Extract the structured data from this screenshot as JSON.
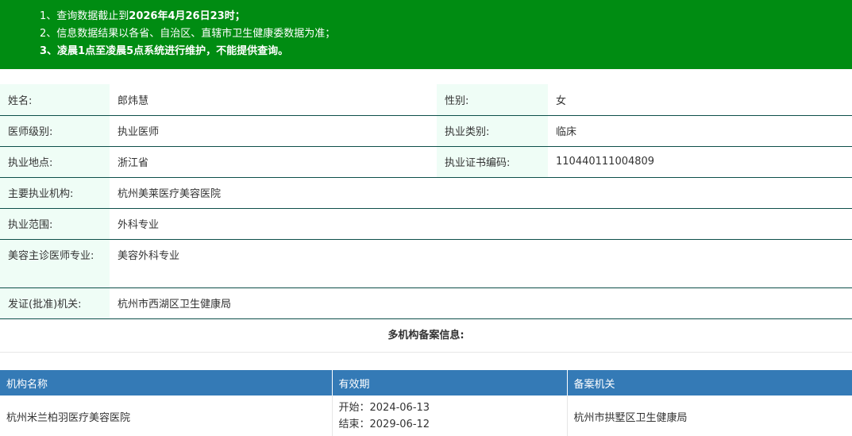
{
  "notice": {
    "line1_prefix": "1、查询数据截止到",
    "line1_bold": "2026年4月26日23时；",
    "line2": "2、信息数据结果以各省、自治区、直辖市卫生健康委数据为准；",
    "line3_prefix": "3、",
    "line3_bold": "凌晨1点至凌晨5点",
    "line3_suffix": "系统进行维护，不能提供查询。"
  },
  "info": {
    "name_label": "姓名:",
    "name_value": "郎炜慧",
    "gender_label": "性别:",
    "gender_value": "女",
    "level_label": "医师级别:",
    "level_value": "执业医师",
    "category_label": "执业类别:",
    "category_value": "临床",
    "location_label": "执业地点:",
    "location_value": "浙江省",
    "cert_label": "执业证书编码:",
    "cert_value": "110440111004809",
    "institution_label": "主要执业机构:",
    "institution_value": "杭州美莱医疗美容医院",
    "scope_label": "执业范围:",
    "scope_value": "外科专业",
    "cosmetic_label": "美容主诊医师专业:",
    "cosmetic_value": "美容外科专业",
    "issuer_label": "发证(批准)机关:",
    "issuer_value": "杭州市西湖区卫生健康局"
  },
  "multi": {
    "title": "多机构备案信息:",
    "headers": [
      "机构名称",
      "有效期",
      "备案机关"
    ],
    "rows": [
      {
        "name": "杭州米兰柏羽医疗美容医院",
        "start": "开始：2024-06-13",
        "end": "结束：2029-06-12",
        "authority": "杭州市拱墅区卫生健康局"
      }
    ]
  },
  "colors": {
    "notice_bg": "#008c12",
    "label_bg": "#effdf6",
    "header_bg": "#347ab6",
    "row_border": "#0d4f4a"
  }
}
